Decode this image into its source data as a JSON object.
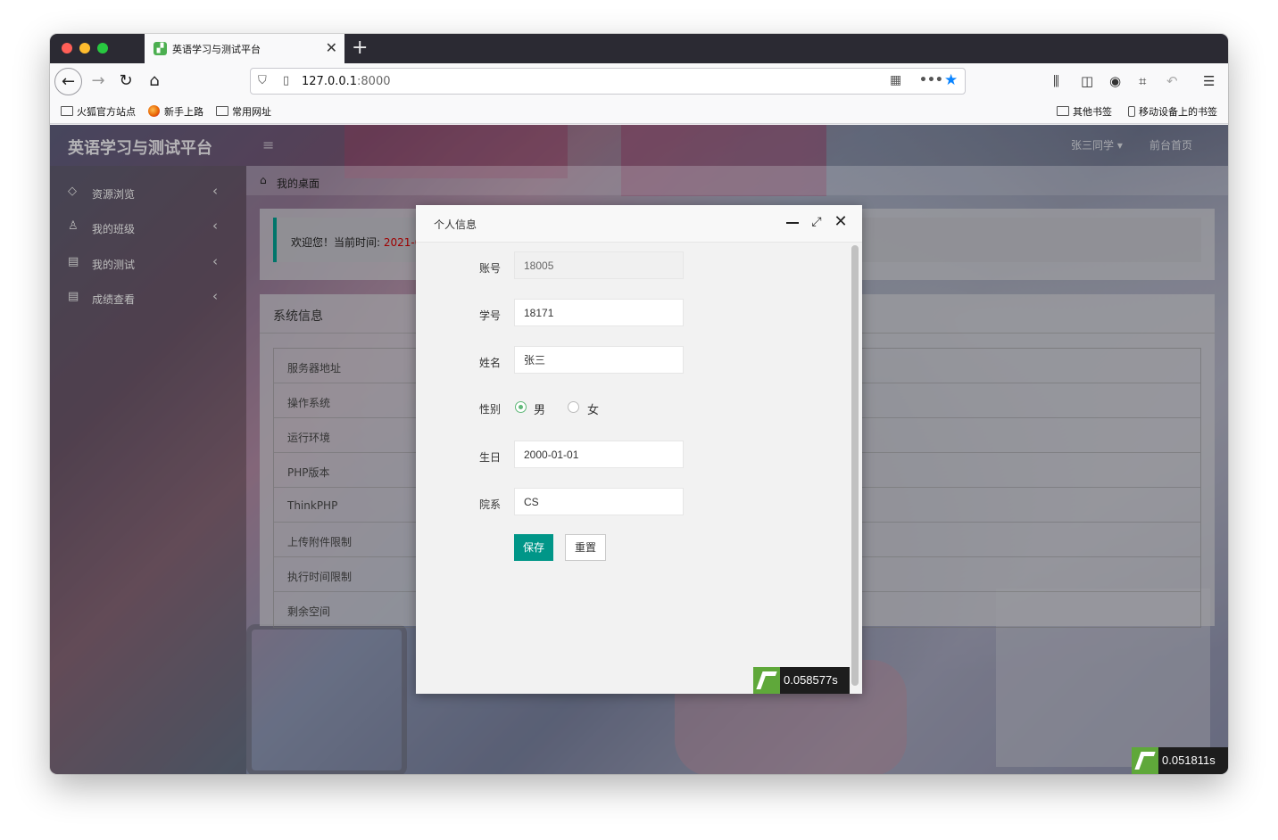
{
  "browser": {
    "tab_title": "英语学习与测试平台",
    "url_host": "127.0.0.1",
    "url_port": ":8000",
    "bookmarks_left": [
      "火狐官方站点",
      "新手上路",
      "常用网址"
    ],
    "bookmarks_right": [
      "其他书签",
      "移动设备上的书签"
    ]
  },
  "app": {
    "brand": "英语学习与测试平台",
    "user_menu": "张三同学",
    "home_link": "前台首页",
    "sidebar": [
      {
        "label": "资源浏览",
        "icon": "diamond-icon"
      },
      {
        "label": "我的班级",
        "icon": "user-icon"
      },
      {
        "label": "我的测试",
        "icon": "form-icon"
      },
      {
        "label": "成绩查看",
        "icon": "form-icon"
      }
    ],
    "breadcrumb": "我的桌面",
    "welcome_prefix": "欢迎您！当前时间:",
    "welcome_time": "2021-0",
    "system_info_title": "系统信息",
    "system_info_rows": [
      "服务器地址",
      "操作系统",
      "运行环境",
      "PHP版本",
      "ThinkPHP",
      "上传附件限制",
      "执行时间限制",
      "剩余空间"
    ],
    "page_perf": "0.051811s"
  },
  "modal": {
    "title": "个人信息",
    "fields": {
      "account": {
        "label": "账号",
        "value": "18005"
      },
      "student_id": {
        "label": "学号",
        "value": "18171"
      },
      "name": {
        "label": "姓名",
        "value": "张三"
      },
      "gender": {
        "label": "性别",
        "options": [
          "男",
          "女"
        ],
        "selected": "男"
      },
      "birthday": {
        "label": "生日",
        "value": "2000-01-01"
      },
      "department": {
        "label": "院系",
        "value": "CS"
      }
    },
    "save_label": "保存",
    "reset_label": "重置",
    "perf": "0.058577s"
  },
  "colors": {
    "accent": "#009688",
    "radio": "#5fb878",
    "star": "#0a84ff"
  }
}
